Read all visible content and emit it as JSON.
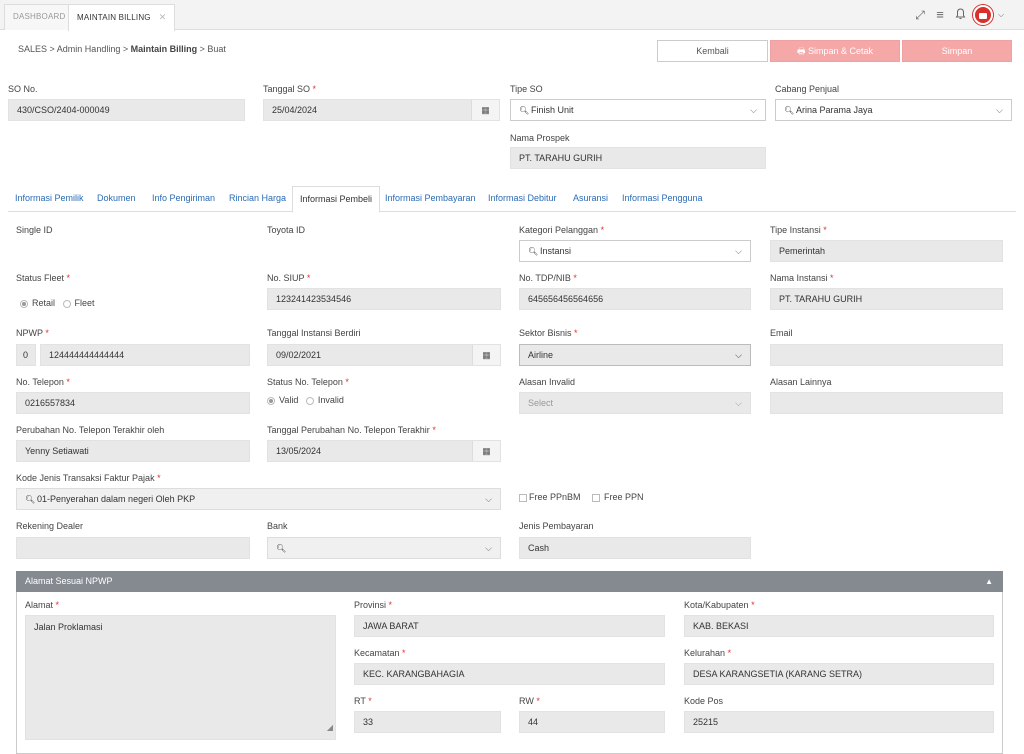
{
  "top_tabs": [
    {
      "label": "DASHBOARD"
    },
    {
      "label": "MAINTAIN BILLING"
    }
  ],
  "top_icons": {
    "fullscreen": "⤢",
    "menu": "≡",
    "bell": "🔔"
  },
  "breadcrumb": {
    "l1": "SALES",
    "l2": "Admin Handling",
    "l3": "Maintain Billing",
    "l4": "Buat"
  },
  "buttons": {
    "back": "Kembali",
    "save_print": "Simpan & Cetak",
    "save": "Simpan"
  },
  "header": {
    "so_no_label": "SO No.",
    "so_no": "430/CSO/2404-000049",
    "tanggal_so_label": "Tanggal SO",
    "tanggal_so": "25/04/2024",
    "tipe_so_label": "Tipe SO",
    "tipe_so": "Finish Unit",
    "cabang_label": "Cabang Penjual",
    "cabang": "Arina Parama Jaya",
    "prospek_label": "Nama Prospek",
    "prospek": "PT. TARAHU GURIH"
  },
  "section_tabs": [
    "Informasi Pemilik",
    "Dokumen",
    "Info Pengiriman",
    "Rincian Harga",
    "Informasi Pembeli",
    "Informasi Pembayaran",
    "Informasi Debitur",
    "Asuransi",
    "Informasi Pengguna"
  ],
  "form": {
    "single_id_label": "Single ID",
    "toyota_id_label": "Toyota ID",
    "kategori_label": "Kategori Pelanggan",
    "kategori": "Instansi",
    "tipe_instansi_label": "Tipe Instansi",
    "tipe_instansi": "Pemerintah",
    "status_fleet_label": "Status Fleet",
    "fleet_retail": "Retail",
    "fleet_fleet": "Fleet",
    "siup_label": "No. SIUP",
    "siup": "123241423534546",
    "tdp_label": "No. TDP/NIB",
    "tdp": "645656456564656",
    "nama_instansi_label": "Nama Instansi",
    "nama_instansi": "PT. TARAHU GURIH",
    "npwp_label": "NPWP",
    "npwp_prefix": "0",
    "npwp": "124444444444444",
    "tgl_berdiri_label": "Tanggal Instansi Berdiri",
    "tgl_berdiri": "09/02/2021",
    "sektor_label": "Sektor Bisnis",
    "sektor": "Airline",
    "email_label": "Email",
    "telp_label": "No. Telepon",
    "telp": "0216557834",
    "status_telp_label": "Status No. Telepon",
    "valid": "Valid",
    "invalid": "Invalid",
    "alasan_invalid_label": "Alasan Invalid",
    "alasan_invalid_ph": "Select",
    "alasan_lain_label": "Alasan Lainnya",
    "perubahan_label": "Perubahan No. Telepon Terakhir oleh",
    "perubahan": "Yenny Setiawati",
    "tgl_perubahan_label": "Tanggal Perubahan No. Telepon Terakhir",
    "tgl_perubahan": "13/05/2024",
    "kode_label": "Kode Jenis Transaksi Faktur Pajak",
    "kode": "01-Penyerahan dalam negeri Oleh PKP",
    "free_ppnbm": "Free PPnBM",
    "free_ppn": "Free PPN",
    "rekening_label": "Rekening Dealer",
    "bank_label": "Bank",
    "jenis_bayar_label": "Jenis Pembayaran",
    "jenis_bayar": "Cash"
  },
  "address": {
    "title": "Alamat Sesuai NPWP",
    "alamat_label": "Alamat",
    "alamat": "Jalan Proklamasi",
    "provinsi_label": "Provinsi",
    "provinsi": "JAWA BARAT",
    "kota_label": "Kota/Kabupaten",
    "kota": "KAB. BEKASI",
    "kecamatan_label": "Kecamatan",
    "kecamatan": "KEC. KARANGBAHAGIA",
    "kelurahan_label": "Kelurahan",
    "kelurahan": "DESA KARANGSETIA (KARANG SETRA)",
    "rt_label": "RT",
    "rt": "33",
    "rw_label": "RW",
    "rw": "44",
    "kodepos_label": "Kode Pos",
    "kodepos": "25215"
  },
  "colors": {
    "accent": "#d9302c",
    "link": "#2a6bb5",
    "panel": "#858990"
  }
}
